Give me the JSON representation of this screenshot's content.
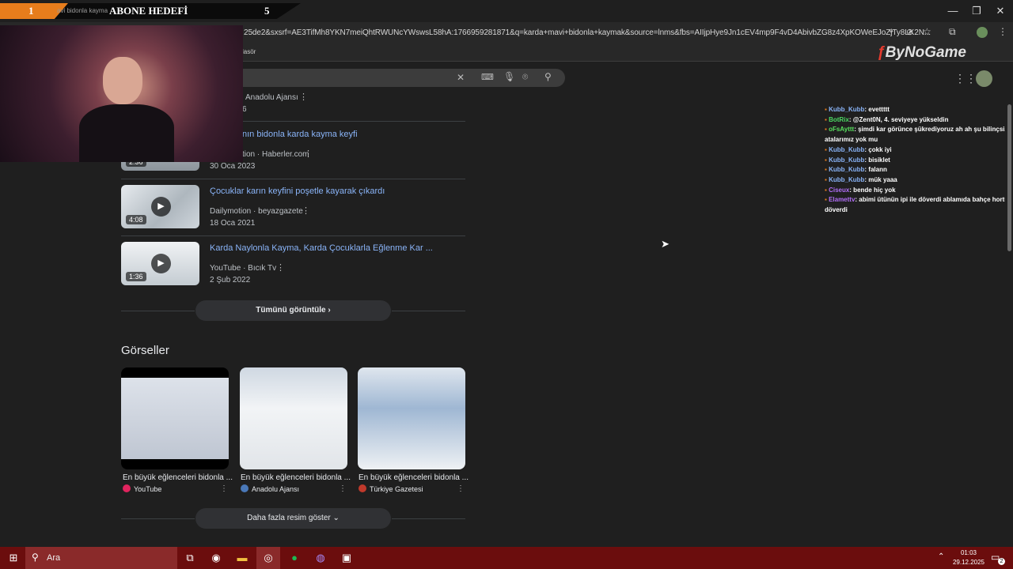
{
  "overlay": {
    "rank": "1",
    "goal_label": "ABONE HEDEFİ",
    "goal_value": "5",
    "tab_fragment": "avi bidonla kayma"
  },
  "browser": {
    "url": "25de2&sxsrf=AE3TifMh8YKN7meiQhtRWUNcYWswsL58hA:1766959281871&q=karda+mavi+bidonla+kaymak&source=lnms&fbs=AIIjpHye9Jn1cEV4mp9F4vD4AbivbZG8z4XpKOWeEJoZjTy8LK2N...",
    "bookmark_fragment": "lasör",
    "watermark": "ByNoGame"
  },
  "videos": [
    {
      "source_partial": "Anadolu Ajansı",
      "date_partial": "6"
    },
    {
      "title": "nın bidonla karda kayma keyfi",
      "meta": "tion · Haberler.com",
      "date": "30 Oca 2023",
      "duration": "2:36"
    },
    {
      "title": "Çocuklar karın keyfini poşetle kayarak çıkardı",
      "meta": "Dailymotion · beyazgazete",
      "date": "18 Oca 2021",
      "duration": "4:08"
    },
    {
      "title": "Karda Naylonla Kayma, Karda Çocuklarla Eğlenme Kar ...",
      "meta": "YouTube · Bıcık Tv",
      "date": "2 Şub 2022",
      "duration": "1:36"
    }
  ],
  "see_all": "Tümünü görüntüle",
  "images_heading": "Görseller",
  "images": [
    {
      "caption": "En büyük eğlenceleri bidonla ...",
      "source": "YouTube"
    },
    {
      "caption": "En büyük eğlenceleri bidonla ...",
      "source": "Anadolu Ajansı"
    },
    {
      "caption": "En büyük eğlenceleri bidonla ...",
      "source": "Türkiye Gazetesi"
    }
  ],
  "more_images": "Daha fazla resim göster",
  "chat": [
    {
      "user": "Kubb_Kubb",
      "msg": ": evettttt",
      "color": "#8ab4f8"
    },
    {
      "user": "BotRix",
      "msg": ": @Zent0N, 4. seviyeye yükseldin",
      "color": "#4cd964"
    },
    {
      "user": "oFsAyttt",
      "msg": ": şimdi kar görünce şükrediyoruz ah ah şu bilinçsiz",
      "color": "#58e05e"
    },
    {
      "user": "",
      "msg": "atalarımız yok mu",
      "color": "#ffffff"
    },
    {
      "user": "Kubb_Kubb",
      "msg": ": çokk iyi",
      "color": "#8ab4f8"
    },
    {
      "user": "Kubb_Kubb",
      "msg": ": bisiklet",
      "color": "#8ab4f8"
    },
    {
      "user": "Kubb_Kubb",
      "msg": ": falann",
      "color": "#8ab4f8"
    },
    {
      "user": "Kubb_Kubb",
      "msg": ": mük yaaa",
      "color": "#8ab4f8"
    },
    {
      "user": "Ciseux",
      "msg": ": bende hiç yok",
      "color": "#b06ef5"
    },
    {
      "user": "Elamettv",
      "msg": ": abimi ütünün ipi ile döverdi ablamıda bahçe hortumuyla",
      "color": "#b06ef5"
    },
    {
      "user": "",
      "msg": "döverdi",
      "color": "#ffffff"
    }
  ],
  "taskbar": {
    "search_placeholder": "Ara",
    "time": "01:03",
    "date": "29.12.2025",
    "notif_count": "2"
  }
}
